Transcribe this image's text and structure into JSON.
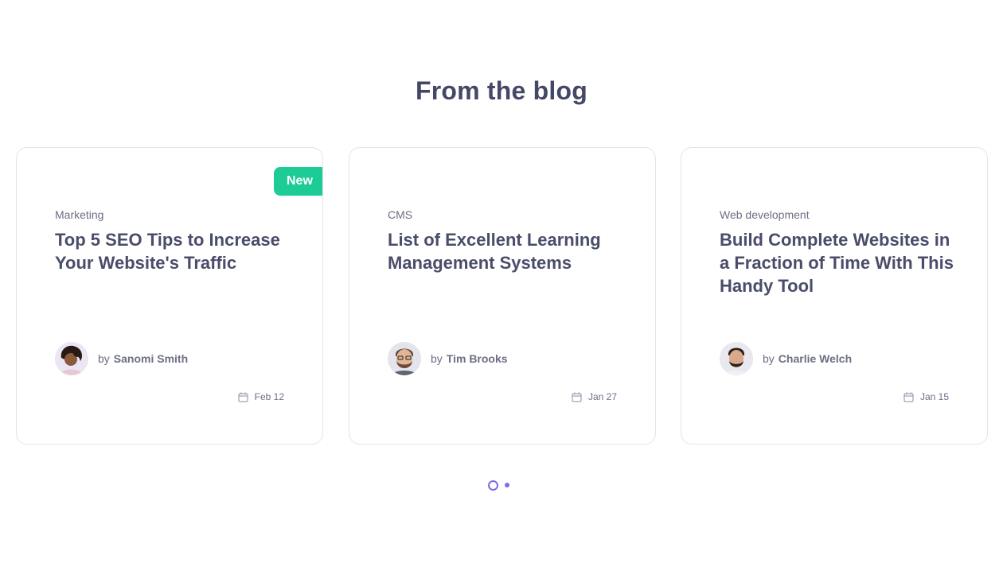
{
  "section": {
    "title": "From the blog"
  },
  "posts": [
    {
      "badge": "New",
      "category": "Marketing",
      "title": "Top 5 SEO Tips to Increase Your Website's Traffic",
      "by": "by",
      "author": "Sanomi Smith",
      "date": "Feb 12"
    },
    {
      "category": "CMS",
      "title": "List of Excellent Learning Management Systems",
      "by": "by",
      "author": "Tim Brooks",
      "date": "Jan 27"
    },
    {
      "category": "Web development",
      "title": "Build Complete Websites in a Fraction of Time With This Handy Tool",
      "by": "by",
      "author": "Charlie Welch",
      "date": "Jan 15"
    }
  ],
  "carousel": {
    "pages": 2,
    "active_page": 1
  },
  "colors": {
    "accent": "#7b6fe8",
    "badge": "#1ccb95",
    "text": "#444766",
    "muted": "#6c6f85"
  },
  "icons": {
    "date": "calendar-icon"
  }
}
